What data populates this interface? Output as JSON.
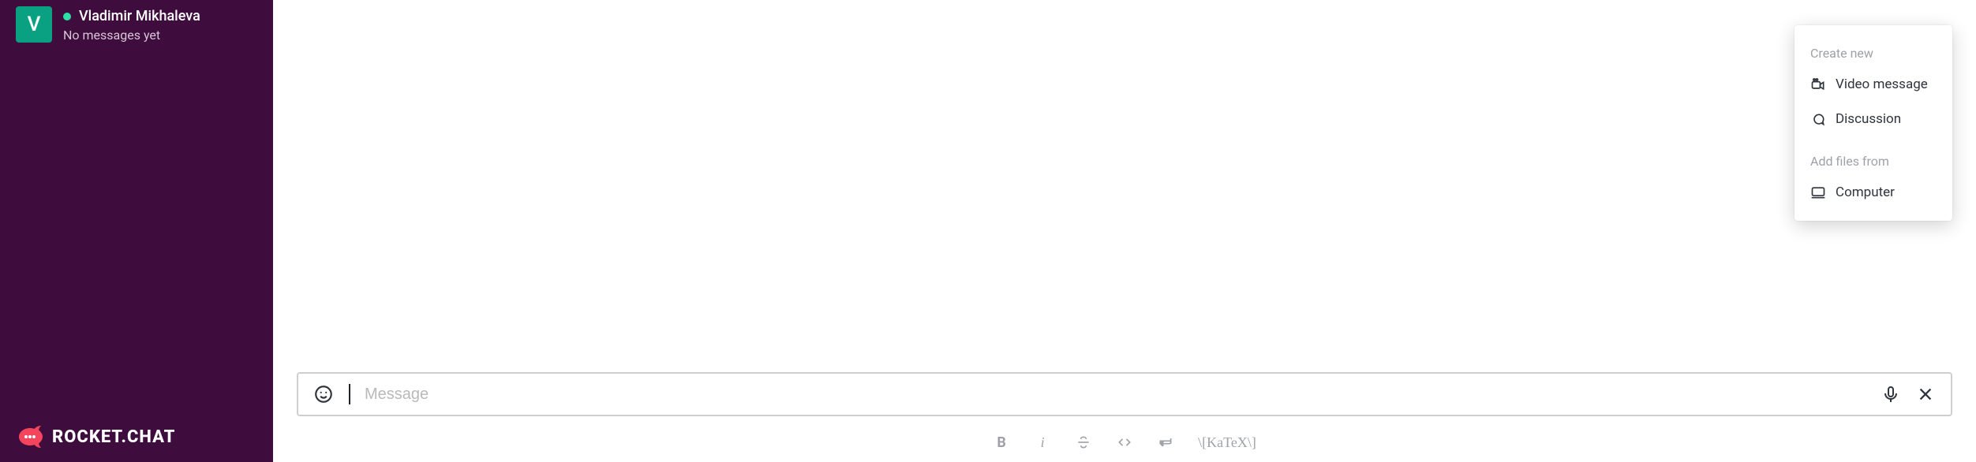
{
  "sidebar": {
    "dm": {
      "avatar_letter": "V",
      "name": "Vladimir Mikhaleva",
      "subtitle": "No messages yet"
    },
    "brand": "ROCKET.CHAT"
  },
  "composer": {
    "placeholder": "Message"
  },
  "toolbar": {
    "bold": "B",
    "italic": "i",
    "katex": "\\[KaTeX\\]"
  },
  "popup": {
    "section_create": "Create new",
    "item_video": "Video message",
    "item_discussion": "Discussion",
    "section_files": "Add files from",
    "item_computer": "Computer"
  }
}
